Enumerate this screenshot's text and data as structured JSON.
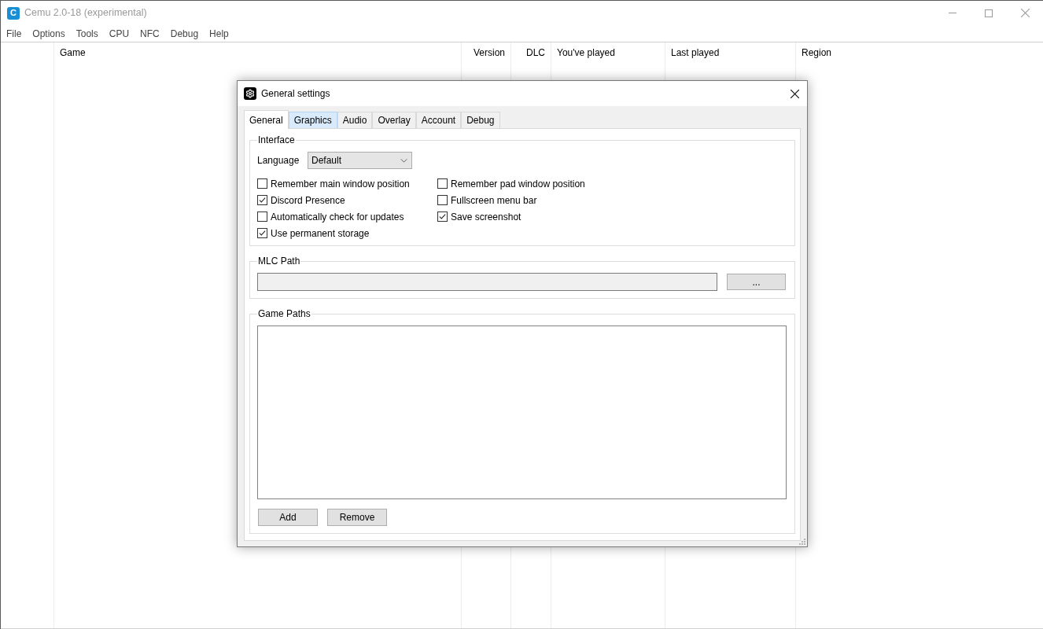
{
  "window": {
    "icon_text": "C",
    "title": "Cemu 2.0-18 (experimental)"
  },
  "menu": [
    "File",
    "Options",
    "Tools",
    "CPU",
    "NFC",
    "Debug",
    "Help"
  ],
  "game_list": {
    "columns": [
      "Game",
      "Version",
      "DLC",
      "You've played",
      "Last played",
      "Region"
    ]
  },
  "dialog": {
    "title": "General settings",
    "tabs": [
      {
        "label": "General",
        "selected": true,
        "hovered": false
      },
      {
        "label": "Graphics",
        "selected": false,
        "hovered": true
      },
      {
        "label": "Audio",
        "selected": false,
        "hovered": false
      },
      {
        "label": "Overlay",
        "selected": false,
        "hovered": false
      },
      {
        "label": "Account",
        "selected": false,
        "hovered": false
      },
      {
        "label": "Debug",
        "selected": false,
        "hovered": false
      }
    ],
    "interface": {
      "title": "Interface",
      "language": {
        "label": "Language",
        "value": "Default"
      },
      "checkbox_columns": [
        {
          "items": [
            {
              "label": "Remember main window position",
              "checked": false
            },
            {
              "label": "Discord Presence",
              "checked": true
            },
            {
              "label": "Automatically check for updates",
              "checked": false
            },
            {
              "label": "Use permanent storage",
              "checked": true
            }
          ]
        },
        {
          "items": [
            {
              "label": "Remember pad window position",
              "checked": false
            },
            {
              "label": "Fullscreen menu bar",
              "checked": false
            },
            {
              "label": "Save screenshot",
              "checked": true
            }
          ]
        }
      ]
    },
    "mlc_path": {
      "title": "MLC Path",
      "disabled": true,
      "browse_button": "..."
    },
    "game_paths": {
      "title": "Game Paths",
      "buttons": [
        "Add",
        "Remove"
      ]
    }
  }
}
